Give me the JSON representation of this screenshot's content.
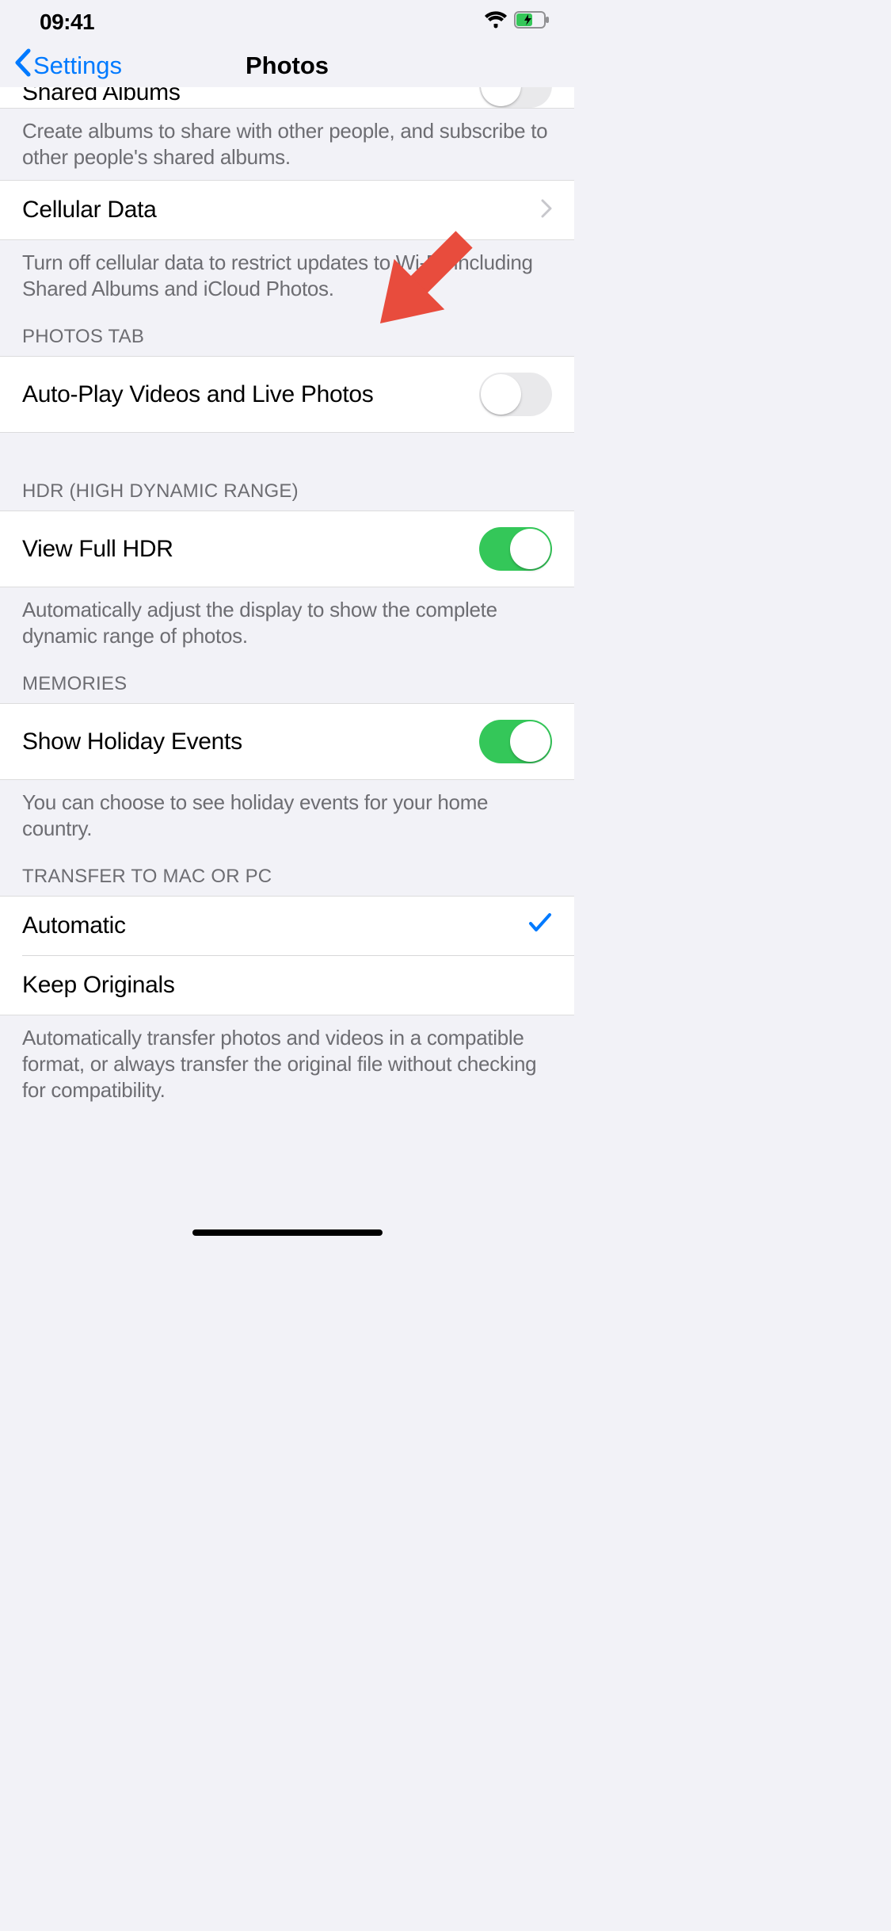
{
  "statusBar": {
    "time": "09:41"
  },
  "navBar": {
    "backLabel": "Settings",
    "title": "Photos"
  },
  "sharedAlbums": {
    "label": "Shared Albums",
    "footer": "Create albums to share with other people, and subscribe to other people's shared albums."
  },
  "cellularData": {
    "label": "Cellular Data",
    "footer": "Turn off cellular data to restrict updates to Wi-Fi, including Shared Albums and iCloud Photos."
  },
  "photosTab": {
    "header": "PHOTOS TAB",
    "autoPlay": {
      "label": "Auto-Play Videos and Live Photos",
      "on": false
    }
  },
  "hdr": {
    "header": "HDR (HIGH DYNAMIC RANGE)",
    "viewFullHdr": {
      "label": "View Full HDR",
      "on": true
    },
    "footer": "Automatically adjust the display to show the complete dynamic range of photos."
  },
  "memories": {
    "header": "MEMORIES",
    "showHoliday": {
      "label": "Show Holiday Events",
      "on": true
    },
    "footer": "You can choose to see holiday events for your home country."
  },
  "transfer": {
    "header": "TRANSFER TO MAC OR PC",
    "automatic": {
      "label": "Automatic",
      "selected": true
    },
    "keepOriginals": {
      "label": "Keep Originals",
      "selected": false
    },
    "footer": "Automatically transfer photos and videos in a compatible format, or always transfer the original file without checking for compatibility."
  }
}
